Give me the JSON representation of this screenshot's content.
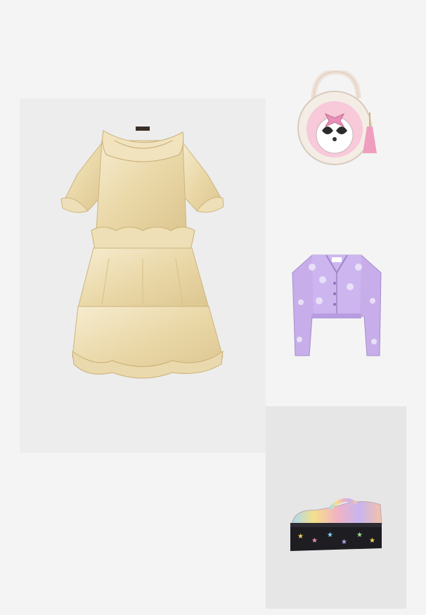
{
  "outfit": {
    "items": [
      {
        "id": "dress",
        "kind": "product-image",
        "icon": "ruffled-cream-dress",
        "color": "#ecdcb0"
      },
      {
        "id": "bag",
        "kind": "product-image",
        "icon": "round-panda-crossbody-bag",
        "color": "#f7c9d9"
      },
      {
        "id": "cardigan",
        "kind": "product-image",
        "icon": "lilac-cropped-cardigan",
        "color": "#c7aeea"
      },
      {
        "id": "shoes",
        "kind": "product-image",
        "icon": "rainbow-platform-mary-jane",
        "color": "#f2c3b1"
      }
    ]
  },
  "colors": {
    "page_bg": "#f4f4f4",
    "dress_tile_bg": "#ededed",
    "shoe_tile_bg": "#e6e6e6"
  }
}
